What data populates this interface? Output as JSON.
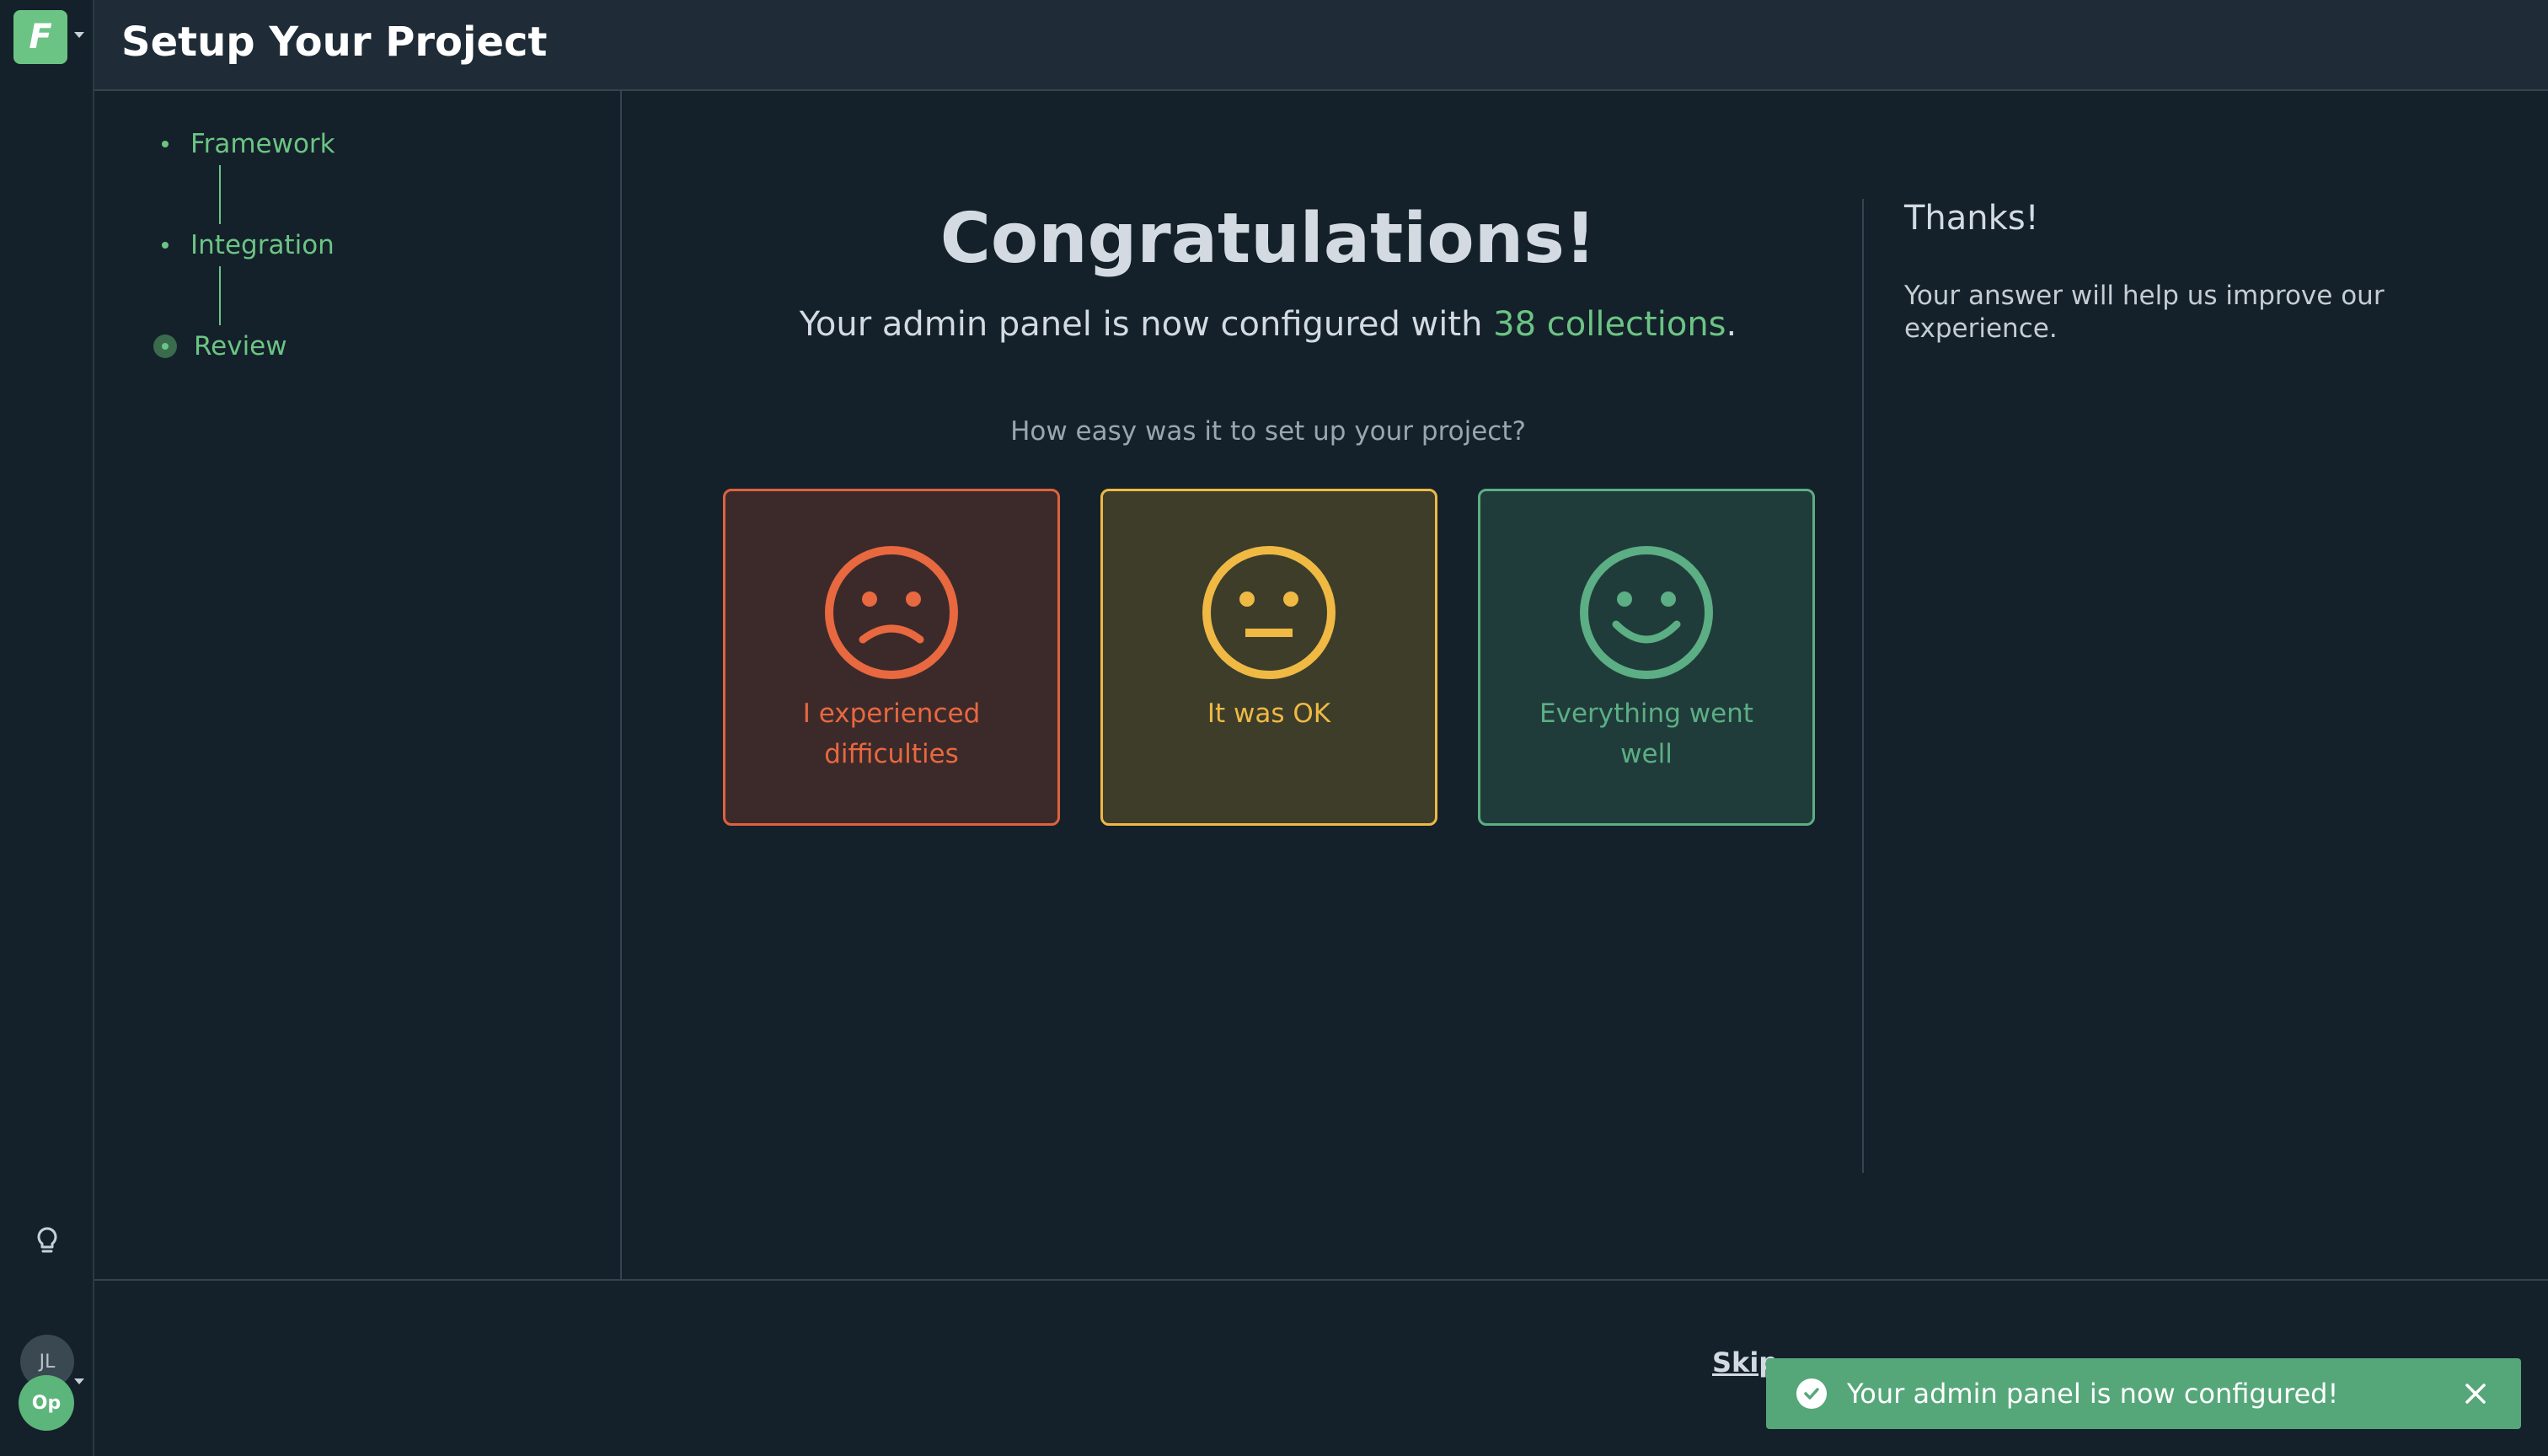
{
  "app": {
    "logo_letter": "F",
    "title": "Setup Your Project"
  },
  "sidebar": {
    "steps": [
      {
        "label": "Framework",
        "state": "complete"
      },
      {
        "label": "Integration",
        "state": "complete"
      },
      {
        "label": "Review",
        "state": "current"
      }
    ],
    "user_initials": "JL",
    "org_initials": "Op",
    "icons": [
      "logo-icon",
      "lightbulb-icon",
      "avatar"
    ]
  },
  "main": {
    "heading": "Congratulations!",
    "subline_prefix": "Your admin panel is now configured with ",
    "subline_accent": "38 collections",
    "subline_suffix": ".",
    "question": "How easy was it to set up your project?",
    "options": [
      {
        "label": "I experienced difficulties",
        "icon": "sad-face-icon",
        "color": "#e0623c"
      },
      {
        "label": "It was OK",
        "icon": "neutral-face-icon",
        "color": "#efb944"
      },
      {
        "label": "Everything went well",
        "icon": "happy-face-icon",
        "color": "#5cae84"
      }
    ]
  },
  "aside": {
    "title": "Thanks!",
    "body": "Your answer will help us improve our experience."
  },
  "footer": {
    "skip_label": "Skip",
    "toast_message": "Your admin panel is now configured!"
  },
  "colors": {
    "background": "#14212a",
    "header": "#1f2c37",
    "accent": "#6cc484",
    "toast": "#55a77a"
  }
}
